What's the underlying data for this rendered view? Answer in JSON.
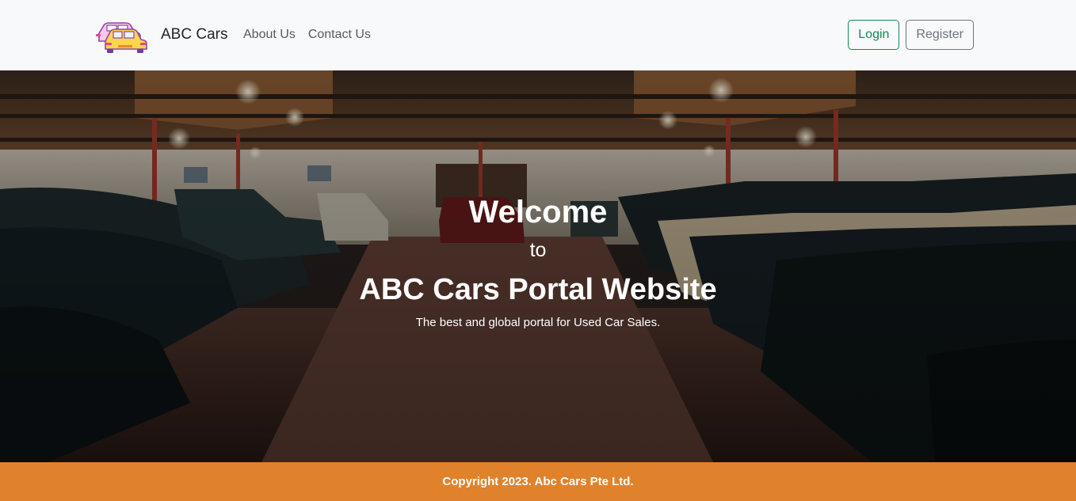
{
  "navbar": {
    "brand_name": "ABC Cars",
    "links": [
      {
        "label": "About Us"
      },
      {
        "label": "Contact Us"
      }
    ],
    "login_label": "Login",
    "register_label": "Register"
  },
  "hero": {
    "welcome": "Welcome",
    "to": "to",
    "title": "ABC Cars Portal Website",
    "tagline": "The best and global portal for Used Car Sales."
  },
  "footer": {
    "copyright": "Copyright 2023. Abc Cars Pte Ltd."
  },
  "colors": {
    "navbar_bg": "#f8f9fa",
    "login_accent": "#198754",
    "register_accent": "#6c757d",
    "footer_bg": "#e0822b"
  },
  "icons": {
    "brand_logo": "car-logo-icon"
  }
}
